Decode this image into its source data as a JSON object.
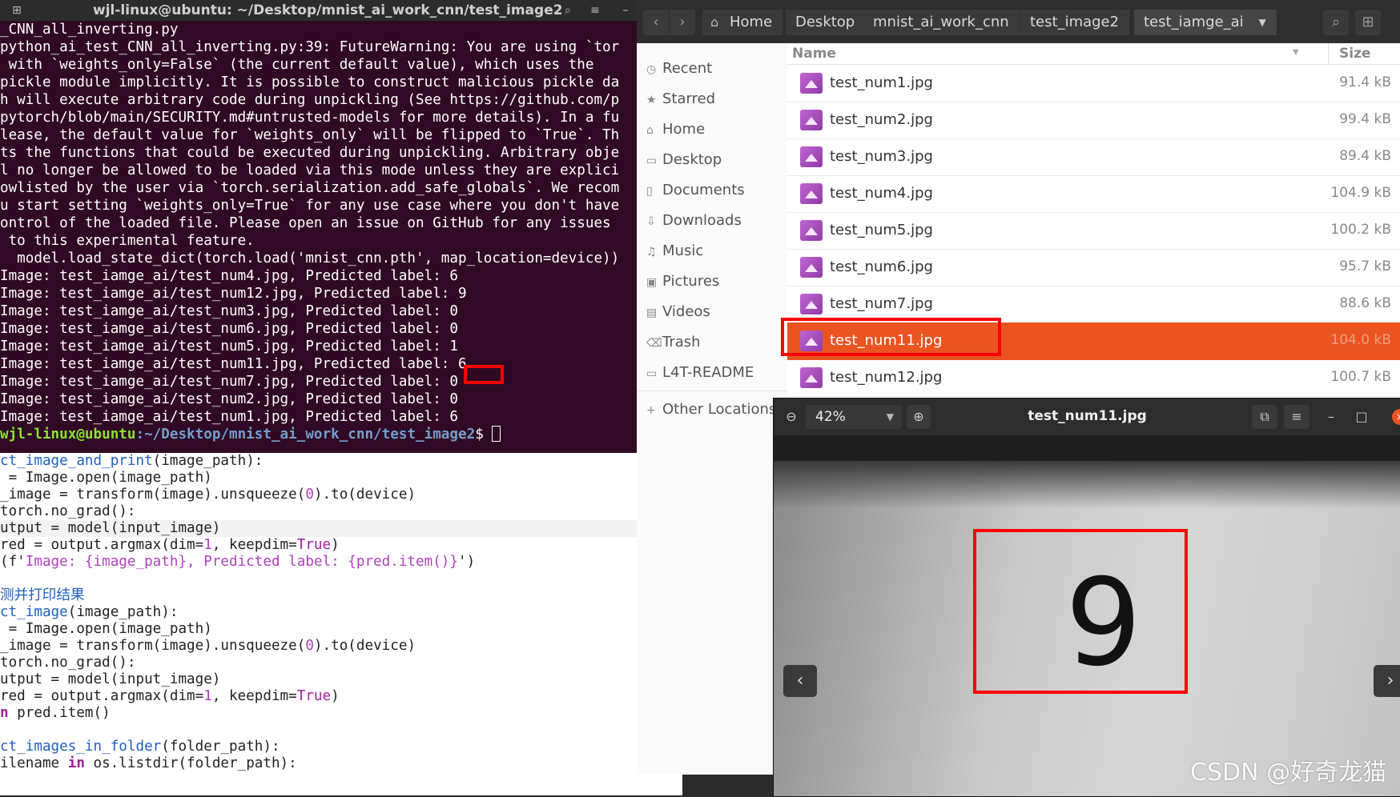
{
  "terminal": {
    "title": "wjl-linux@ubuntu: ~/Desktop/mnist_ai_work_cnn/test_image2",
    "lines": [
      "_CNN_all_inverting.py",
      "python_ai_test_CNN_all_inverting.py:39: FutureWarning: You are using `tor",
      " with `weights_only=False` (the current default value), which uses the ",
      "pickle module implicitly. It is possible to construct malicious pickle da",
      "h will execute arbitrary code during unpickling (See https://github.com/p",
      "pytorch/blob/main/SECURITY.md#untrusted-models for more details). In a fu",
      "lease, the default value for `weights_only` will be flipped to `True`. Th",
      "ts the functions that could be executed during unpickling. Arbitrary obje",
      "l no longer be allowed to be loaded via this mode unless they are explici",
      "owlisted by the user via `torch.serialization.add_safe_globals`. We recom",
      "u start setting `weights_only=True` for any use case where you don't have",
      "ontrol of the loaded file. Please open an issue on GitHub for any issues ",
      " to this experimental feature.",
      "  model.load_state_dict(torch.load('mnist_cnn.pth', map_location=device))",
      "Image: test_iamge_ai/test_num4.jpg, Predicted label: 6",
      "Image: test_iamge_ai/test_num12.jpg, Predicted label: 9",
      "Image: test_iamge_ai/test_num3.jpg, Predicted label: 0",
      "Image: test_iamge_ai/test_num6.jpg, Predicted label: 0",
      "Image: test_iamge_ai/test_num5.jpg, Predicted label: 1",
      "Image: test_iamge_ai/test_num11.jpg, Predicted label: 6",
      "Image: test_iamge_ai/test_num7.jpg, Predicted label: 0",
      "Image: test_iamge_ai/test_num2.jpg, Predicted label: 0",
      "Image: test_iamge_ai/test_num1.jpg, Predicted label: 6"
    ],
    "prompt_user": "wjl-linux@ubuntu",
    "prompt_path": ":~/Desktop/mnist_ai_work_cnn/test_image2",
    "prompt_symbol": "$ "
  },
  "editor": {
    "code_a1": "ct_image_and_print",
    "code_a2": "(image_path):",
    "code_b": " = Image.open(image_path)",
    "code_c1": "_image = transform(image).unsqueeze(",
    "code_c2": "0",
    "code_c3": ").to(device)",
    "code_d": "torch.no_grad():",
    "code_e": "utput = model(input_image)",
    "code_f1": "red = output.argmax(dim=",
    "code_f2": "1",
    "code_f3": ", keepdim=",
    "code_f4": "True",
    "code_f5": ")",
    "code_g1": "(f'",
    "code_g2": "Image: {image_path}, Predicted label: {pred.item()}",
    "code_g3": "')",
    "code_h": "测并打印结果",
    "code_i1": "ct_image",
    "code_i2": "(image_path):",
    "code_j": " = Image.open(image_path)",
    "code_k1": "_image = transform(image).unsqueeze(",
    "code_k2": "0",
    "code_k3": ").to(device)",
    "code_l": "torch.no_grad():",
    "code_m": "utput = model(input_image)",
    "code_n1": "red = output.argmax(dim=",
    "code_n2": "1",
    "code_n3": ", keepdim=",
    "code_n4": "True",
    "code_n5": ")",
    "code_o1": "n",
    "code_o2": " pred.item()",
    "code_p1": "ct_images_in_folder",
    "code_p2": "(folder_path):",
    "code_q1": "ilename ",
    "code_q2": "in",
    "code_q3": " os.listdir(folder_path):"
  },
  "files": {
    "breadcrumbs": [
      "Home",
      "Desktop",
      "mnist_ai_work_cnn",
      "test_image2",
      "test_iamge_ai"
    ],
    "sidebar": [
      "Recent",
      "Starred",
      "Home",
      "Desktop",
      "Documents",
      "Downloads",
      "Music",
      "Pictures",
      "Videos",
      "Trash",
      "L4T-README",
      "Other Locations"
    ],
    "col_name": "Name",
    "col_size": "Size",
    "rows": [
      {
        "name": "test_num1.jpg",
        "size": "91.4 kB"
      },
      {
        "name": "test_num2.jpg",
        "size": "99.4 kB"
      },
      {
        "name": "test_num3.jpg",
        "size": "89.4 kB"
      },
      {
        "name": "test_num4.jpg",
        "size": "104.9 kB"
      },
      {
        "name": "test_num5.jpg",
        "size": "100.2 kB"
      },
      {
        "name": "test_num6.jpg",
        "size": "95.7 kB"
      },
      {
        "name": "test_num7.jpg",
        "size": "88.6 kB"
      },
      {
        "name": "test_num11.jpg",
        "size": "104.0 kB"
      },
      {
        "name": "test_num12.jpg",
        "size": "100.7 kB"
      }
    ],
    "selected_index": 7
  },
  "viewer": {
    "zoom": "42%",
    "title": "test_num11.jpg",
    "digit": "9"
  },
  "watermark": "CSDN @好奇龙猫",
  "colors": {
    "terminal_bg": "#300a24",
    "selection": "#e95420",
    "highlight": "#ff0000"
  }
}
